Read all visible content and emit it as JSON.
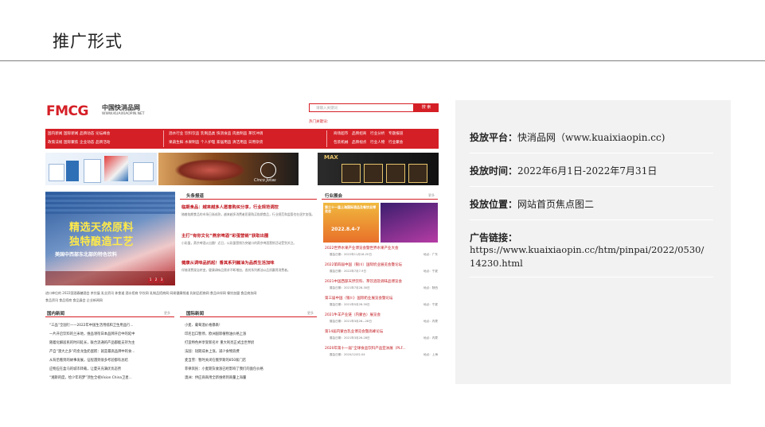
{
  "slide": {
    "title": "推广形式"
  },
  "website": {
    "logo_text": "FMCG",
    "logo_cn": "中国快消品网",
    "logo_url": "WWW.KUAIXIAOPIN.NET",
    "search_placeholder": "请输入关键词",
    "search_button": "搜 索",
    "hot_link": "热门关键词：",
    "nav_row1": [
      "国内新闻",
      "国际新闻",
      "品牌动态",
      "论坛峰会",
      "酒水行业",
      "饮料饮品",
      "乳制品类",
      "快消食品",
      "肉类制品",
      "茶饮冲调",
      "商场超市",
      "品牌招商",
      "行业分析",
      "专题报道"
    ],
    "nav_row2": [
      "政策法规",
      "国际聚焦",
      "企业动态",
      "品牌活动",
      "果蔬生鲜",
      "水果制品",
      "个人护理",
      "家居用品",
      "清洁用品",
      "日用杂货",
      "包装机械",
      "品牌视点",
      "行业人物",
      "行业聚会"
    ],
    "banner3_text": "Cinco Jotas",
    "banner4_text": "MAX",
    "hero_title_1": "精选天然原料",
    "hero_title_2": "独特酿造工艺",
    "hero_sub": "美国中西部东北部的特色饮料",
    "hero_pages": [
      "1",
      "2",
      "3"
    ],
    "headline_col": {
      "title": "头条报道",
      "items": [
        {
          "title": "临期食品：越来越多人愿意购买分享，行业规范调控",
          "desc": "随着临期食品的市场日渐成熟，越来越多消费者愿意购买临期食品，行业规范和监管也在逐步加强。"
        },
        {
          "title": "主打“有你文化”燕京啤酒“彩蛋营销”获取出圈",
          "desc": "小彩蛋，燕京啤酒火出圈！近日，以彩蛋营销为突破口的燕京啤酒营销活动受到关注。"
        },
        {
          "title": "健康从调味品抓起！香其系列酱油为品质生活加味",
          "desc": "伴随消费观念转变，健康调味品需求不断增加，香其系列酱油以品质赢得消费者。"
        }
      ]
    },
    "fair_col": {
      "title": "行业展会",
      "more": "更多",
      "thumb1_text": "第三十一届上海国际酒品及餐饮业博览会",
      "thumb1_date": "2022.8.4-7",
      "items": [
        {
          "title": "2022世界水果产业博览会暨世界水果产业大会",
          "date": "展会日期：2022年11月18-20日",
          "place": "地点：广东"
        },
        {
          "title": "2022第四届中国（银川）国际奶业展览会暨论坛",
          "date": "展会日期：2022年7月7-9日",
          "place": "地点：宁夏"
        },
        {
          "title": "2021中国西部天然饮料、茶饮酒及调味品博览会",
          "date": "展会日期：2021年7月28-30日",
          "place": "地点：陕西"
        },
        {
          "title": "第三届中国（银川）国际奶业展览会暨论坛",
          "date": "展会日期：2021年5月28-30日",
          "place": "地点：宁夏"
        },
        {
          "title": "2021牛羊产业链（内蒙古）展览会",
          "date": "展会日期：2021年3月26—28日",
          "place": "地点：内蒙"
        },
        {
          "title": "第14届内蒙古乳业博览会暨高峰论坛",
          "date": "展会日期：2021年3月26-28日",
          "place": "地点：内蒙"
        },
        {
          "title": "2020年第十一届“全球食品饮料产品亚洲展（PLF...",
          "date": "展会日期：2020/12/02-04",
          "place": "地点：上海"
        }
      ]
    },
    "link_row1": "进口单位的  2022国酒春糖酒会  茶饮展  乳业资讯  休食道  酒水招商  华饮网  乳制品招商网  网易健康频道  乳制品招商网  食品伙伴网  餐饮加盟  食品商务网",
    "link_row2": "食品资讯 食品招商 食品展会 企业新闻网",
    "domestic": {
      "title": "国内新闻",
      "more": "更多",
      "items": [
        "“三品”全国行——2022年中国生活用纸和卫生用品行...",
        "一片开启饮料的兰米地，维品领衔日本品牌开启中的延中",
        "随着化解居民的时间延长，联合流通的产品都能支持为主",
        "产自“澳大之多”的金龙鱼奶蛋糕：就是最高品牌中的食...",
        "从背后看到的故事发展，征程遇到很多考验都有总结",
        "应物应在盒马的城市转载，让夏天充满优优态势",
        "“湘斯的度，绘少年的梦”顶生全视Vision China卫星..."
      ]
    },
    "international": {
      "title": "国际新闻",
      "more": "更多",
      "items": [
        "小麦、葡萄酒价格暴跌!",
        "印尼出口暂停，欧洲国际植物油价格上涨",
        "打造特色并享受新名片 重大利亮正式出世界奶",
        "法国：短期成本上涨，减少食物浪费",
        "麦当劳：暂时关闭在俄罗斯的850家门店",
        "菲律宾民：小麦期货收涨已经影响了我们的面包价格",
        "澳洲：供应商商用全新维修到商量上海量"
      ]
    }
  },
  "info": {
    "platform_label": "投放平台：",
    "platform_value": "快消品网（www.kuaixiaopin.cc)",
    "time_label": "投放时间：",
    "time_value": "2022年6月1日-2022年7月31日",
    "position_label": "投放位置：",
    "position_value": "网站首页焦点图二",
    "link_label": "广告链接：",
    "link_value": "https://www.kuaixiaopin.cc/htm/pinpai/2022/0530/14230.html"
  }
}
